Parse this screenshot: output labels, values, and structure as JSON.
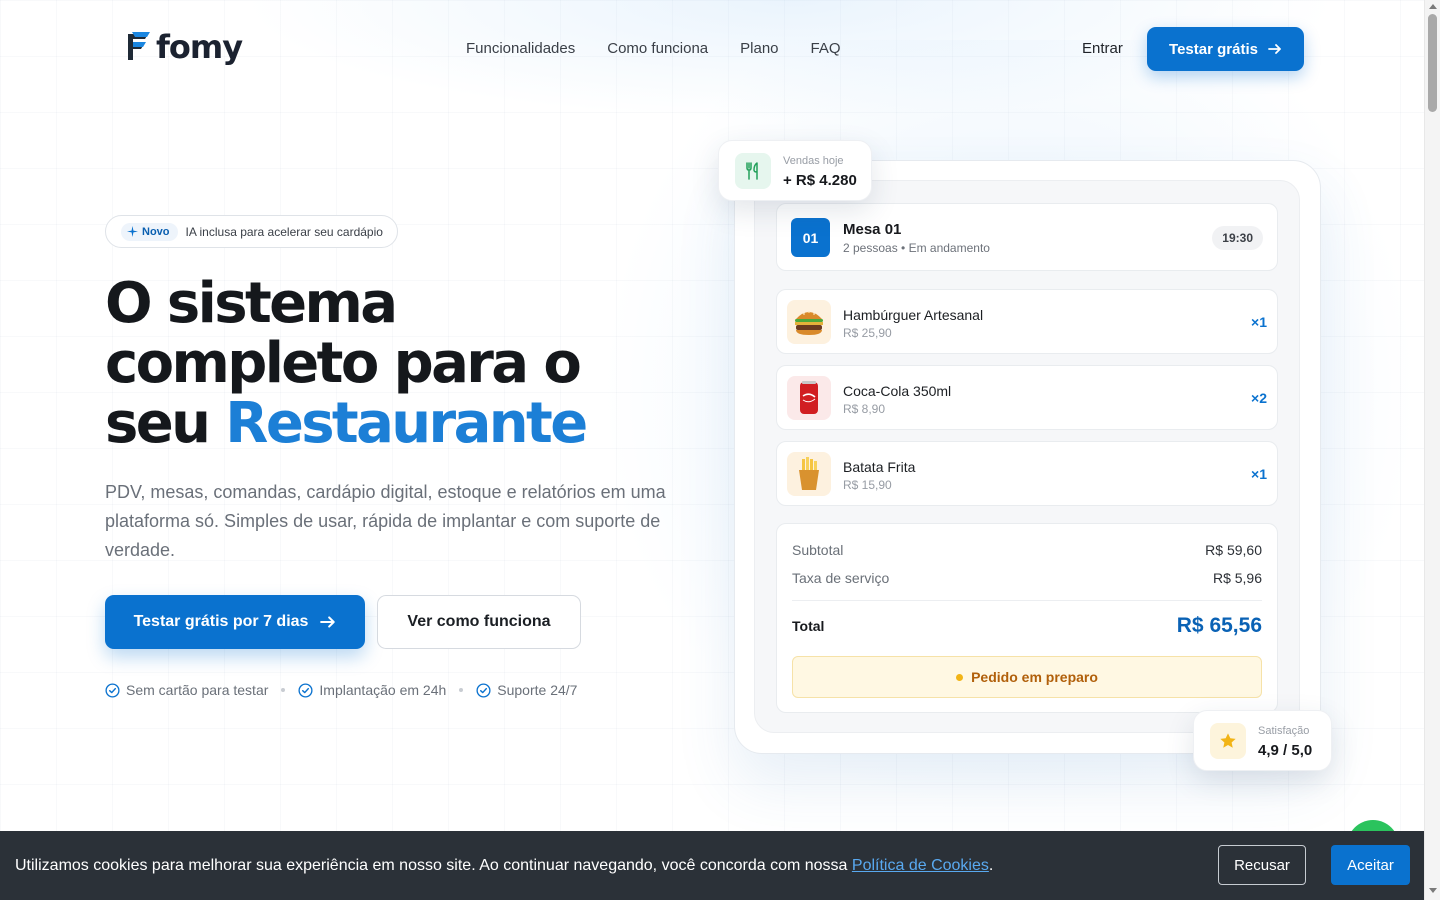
{
  "brand": {
    "name": "fomy",
    "color": "#0a72cf",
    "accent": "#1c7fd6"
  },
  "nav": {
    "items": [
      {
        "label": "Funcionalidades"
      },
      {
        "label": "Como funciona"
      },
      {
        "label": "Plano"
      },
      {
        "label": "FAQ"
      }
    ],
    "login_label": "Entrar",
    "cta_label": "Testar grátis"
  },
  "hero": {
    "badge_tag": "Novo",
    "badge_text": "IA inclusa para acelerar seu cardápio",
    "title_line1": "O sistema",
    "title_line2": "completo para o",
    "title_line3_plain": "seu",
    "title_line3_accent": "Restaurante",
    "subtitle": "PDV, mesas, comandas, cardápio digital, estoque e relatórios em uma plataforma só. Simples de usar, rápida de implantar e com suporte de verdade.",
    "primary_cta": "Testar grátis por 7 dias",
    "secondary_cta": "Ver como funciona",
    "perks": [
      "Sem cartão para testar",
      "Implantação em 24h",
      "Suporte 24/7"
    ]
  },
  "mockup": {
    "sales_card": {
      "label": "Vendas hoje",
      "value": "+ R$ 4.280",
      "icon": "utensils-icon"
    },
    "table": {
      "number": "01",
      "title": "Mesa 01",
      "subtitle": "2 pessoas • Em andamento",
      "time": "19:30"
    },
    "items": [
      {
        "name": "Hambúrguer Artesanal",
        "price": "R$ 25,90",
        "qty": "×1",
        "icon": "burger-icon"
      },
      {
        "name": "Coca-Cola 350ml",
        "price": "R$ 8,90",
        "qty": "×2",
        "icon": "soda-can-icon"
      },
      {
        "name": "Batata Frita",
        "price": "R$ 15,90",
        "qty": "×1",
        "icon": "fries-icon"
      }
    ],
    "totals": {
      "subtotal_label": "Subtotal",
      "subtotal_value": "R$ 59,60",
      "service_label": "Taxa de serviço",
      "service_value": "R$ 5,96",
      "total_label": "Total",
      "total_value": "R$ 65,56",
      "status": "Pedido em preparo"
    },
    "rating_card": {
      "label": "Satisfação",
      "value": "4,9 / 5,0",
      "icon": "star-icon"
    }
  },
  "cookie": {
    "text": "Utilizamos cookies para melhorar sua experiência em nosso site. Ao continuar navegando, você concorda com nossa",
    "link": "Política de Cookies",
    "end": ".",
    "refuse": "Recusar",
    "accept": "Aceitar"
  }
}
